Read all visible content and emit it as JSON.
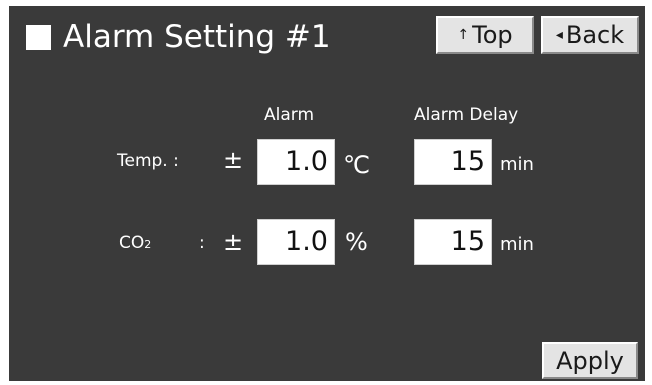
{
  "header": {
    "title": "Alarm Setting #1",
    "top_label": "Top",
    "back_label": "Back",
    "top_icon": "arrow-up-icon",
    "back_icon": "triangle-left-icon"
  },
  "columns": {
    "alarm": "Alarm",
    "alarm_delay": "Alarm Delay"
  },
  "rows": [
    {
      "label": "Temp. :",
      "plus_minus": "±",
      "alarm_value": "1.0",
      "unit": "℃",
      "delay_value": "15",
      "delay_unit": "min"
    },
    {
      "label_main": "CO",
      "label_sub": "2",
      "label_colon": ":",
      "plus_minus": "±",
      "alarm_value": "1.0",
      "unit": "%",
      "delay_value": "15",
      "delay_unit": "min"
    }
  ],
  "footer": {
    "apply_label": "Apply"
  },
  "colors": {
    "background": "#3a3a3a",
    "button": "#e4e4e4",
    "field": "#ffffff",
    "text": "#ffffff"
  }
}
